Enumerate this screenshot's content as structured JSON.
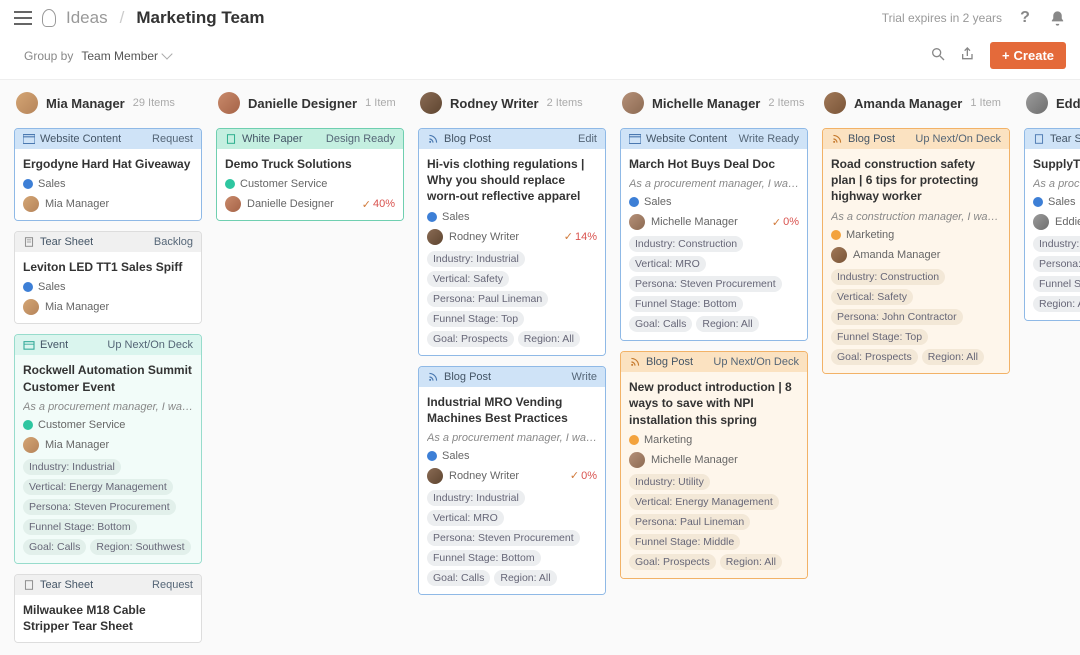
{
  "breadcrumb": {
    "section": "Ideas",
    "page": "Marketing Team"
  },
  "trial": "Trial expires in 2 years",
  "groupby": {
    "label": "Group by",
    "value": "Team Member"
  },
  "create": "Create",
  "columns": [
    {
      "name": "Mia Manager",
      "count": "29 Items",
      "avatar": "a1"
    },
    {
      "name": "Danielle Designer",
      "count": "1 Item",
      "avatar": "a2"
    },
    {
      "name": "Rodney Writer",
      "count": "2 Items",
      "avatar": "a3"
    },
    {
      "name": "Michelle Manager",
      "count": "2 Items",
      "avatar": "a4"
    },
    {
      "name": "Amanda Manager",
      "count": "1 Item",
      "avatar": "a5"
    },
    {
      "name": "Eddie Ed",
      "count": "",
      "avatar": "a6"
    }
  ],
  "cards": {
    "c0": {
      "type": "Website Content",
      "status": "Request",
      "title": "Ergodyne Hard Hat Giveaway",
      "cat": "Sales",
      "owner": "Mia Manager"
    },
    "c1": {
      "type": "Tear Sheet",
      "status": "Backlog",
      "title": "Leviton LED TT1 Sales Spiff",
      "cat": "Sales",
      "owner": "Mia Manager"
    },
    "c2": {
      "type": "Event",
      "status": "Up Next/On Deck",
      "title": "Rockwell Automation Summit Customer Event",
      "story": "As a procurement manager, I want to under…",
      "cat": "Customer Service",
      "owner": "Mia Manager",
      "tags": [
        "Industry: Industrial",
        "Vertical: Energy Management",
        "Persona: Steven Procurement",
        "Funnel Stage: Bottom",
        "Goal: Calls",
        "Region: Southwest"
      ]
    },
    "c3": {
      "type": "Tear Sheet",
      "status": "Request",
      "title": "Milwaukee M18 Cable Stripper Tear Sheet"
    },
    "c4": {
      "type": "White Paper",
      "status": "Design Ready",
      "title": "Demo Truck Solutions",
      "cat": "Customer Service",
      "owner": "Danielle Designer",
      "pct": "40%"
    },
    "c5": {
      "type": "Blog Post",
      "status": "Edit",
      "title": "Hi-vis clothing regulations | Why you should replace worn-out reflective apparel",
      "cat": "Sales",
      "owner": "Rodney Writer",
      "pct": "14%",
      "tags": [
        "Industry: Industrial",
        "Vertical: Safety",
        "Persona: Paul Lineman",
        "Funnel Stage: Top",
        "Goal: Prospects",
        "Region: All"
      ]
    },
    "c6": {
      "type": "Blog Post",
      "status": "Write",
      "title": "Industrial MRO Vending Machines Best Practices",
      "story": "As a procurement manager, I want to maxi…",
      "cat": "Sales",
      "owner": "Rodney Writer",
      "pct": "0%",
      "tags": [
        "Industry: Industrial",
        "Vertical: MRO",
        "Persona: Steven Procurement",
        "Funnel Stage: Bottom",
        "Goal: Calls",
        "Region: All"
      ]
    },
    "c7": {
      "type": "Website Content",
      "status": "Write Ready",
      "title": "March Hot Buys Deal Doc",
      "story": "As a procurement manager, I want to know …",
      "cat": "Sales",
      "owner": "Michelle Manager",
      "pct": "0%",
      "tags": [
        "Industry: Construction",
        "Vertical: MRO",
        "Persona: Steven Procurement",
        "Funnel Stage: Bottom",
        "Goal: Calls",
        "Region: All"
      ]
    },
    "c8": {
      "type": "Blog Post",
      "status": "Up Next/On Deck",
      "title": "New product introduction | 8 ways to save with NPI installation this spring",
      "cat": "Marketing",
      "owner": "Michelle Manager",
      "tags": [
        "Industry: Utility",
        "Vertical: Energy Management",
        "Persona: Paul Lineman",
        "Funnel Stage: Middle",
        "Goal: Prospects",
        "Region: All"
      ]
    },
    "c9": {
      "type": "Blog Post",
      "status": "Up Next/On Deck",
      "title": "Road construction safety plan | 6 tips for protecting highway worker",
      "story": "As a construction manager, I want to know …",
      "cat": "Marketing",
      "owner": "Amanda Manager",
      "tags": [
        "Industry: Construction",
        "Vertical: Safety",
        "Persona: John Contractor",
        "Funnel Stage: Top",
        "Goal: Prospects",
        "Region: All"
      ]
    },
    "c10": {
      "type": "Tear Sheet",
      "status": "",
      "title": "SupplyTrax™",
      "story": "As a procuremen",
      "cat": "Sales",
      "owner": "Eddie Editor",
      "tags": [
        "Industry: Indus",
        "Persona: Steve",
        "Funnel Stage: E",
        "Region: All"
      ]
    }
  }
}
